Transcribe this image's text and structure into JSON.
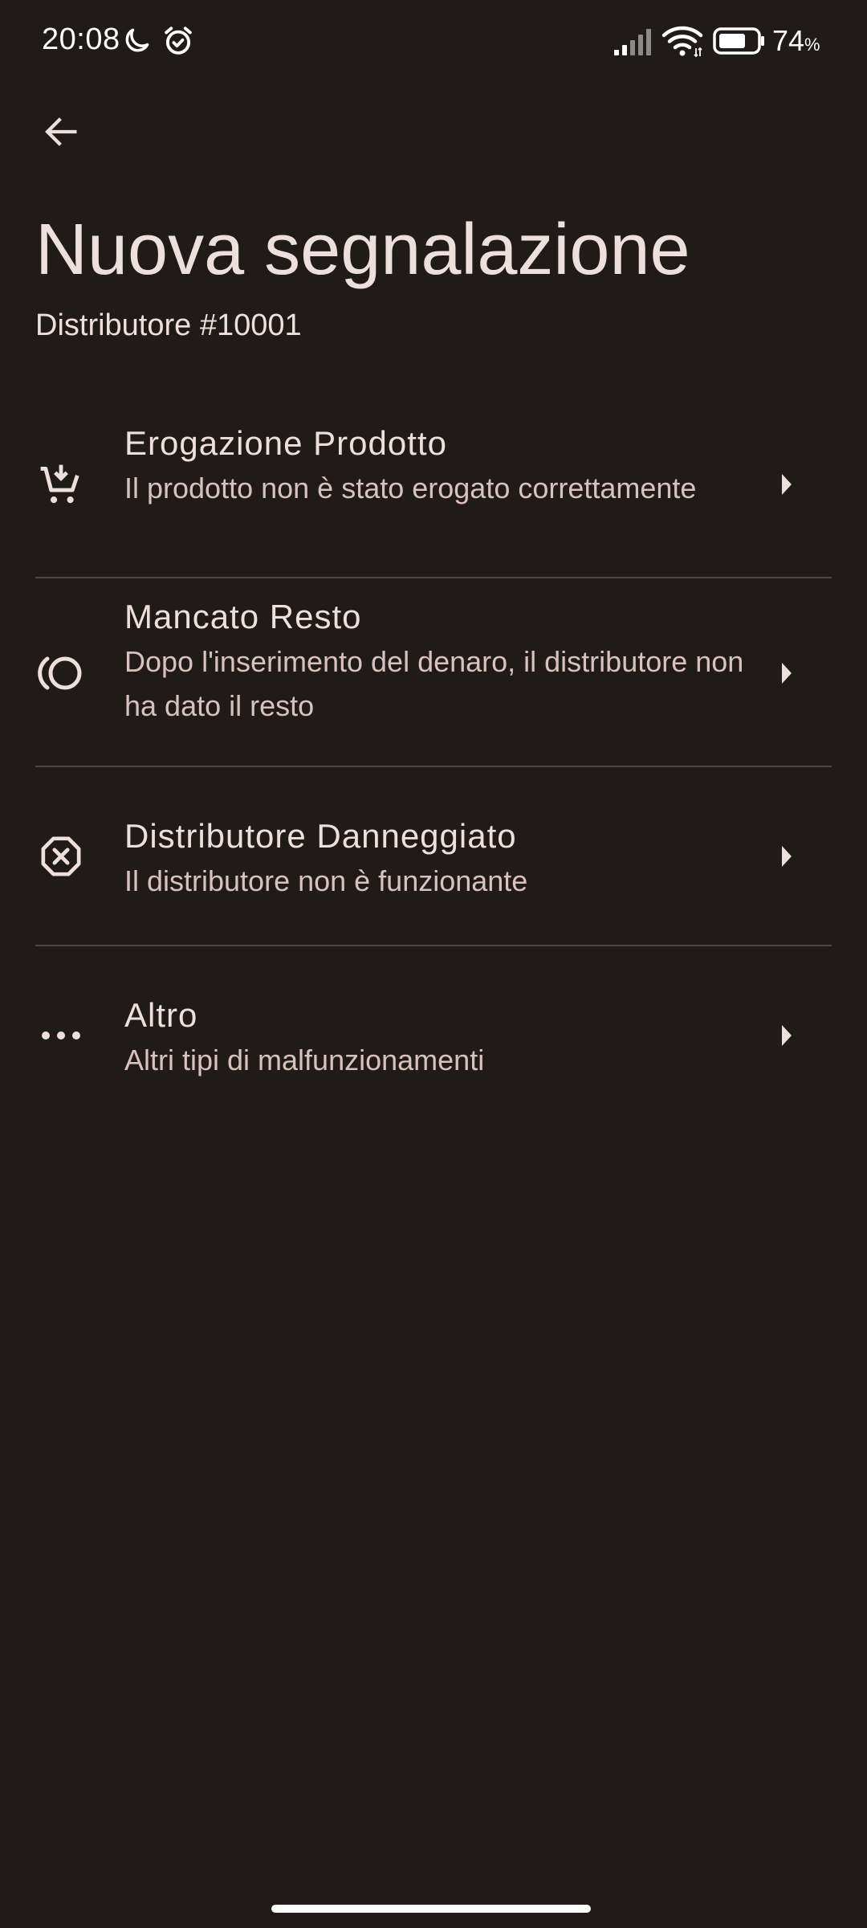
{
  "status_bar": {
    "time": "20:08",
    "battery_percent": "74",
    "battery_unit": "%",
    "icons": [
      "moon-icon",
      "alarm-icon",
      "signal-icon",
      "wifi-icon",
      "battery-icon"
    ]
  },
  "app_bar": {
    "back_icon": "arrow-back-icon",
    "title": "Nuova segnalazione",
    "subtitle": "Distributore #10001"
  },
  "issues": [
    {
      "icon": "cart-icon",
      "title": "Erogazione Prodotto",
      "description": "Il prodotto non è stato erogato correttamente"
    },
    {
      "icon": "coins-icon",
      "title": "Mancato Resto",
      "description": "Dopo l'inserimento del denaro, il distributore non ha dato il resto"
    },
    {
      "icon": "cancel-octagon-icon",
      "title": "Distributore Danneggiato",
      "description": "Il distributore non è funzionante"
    },
    {
      "icon": "more-horiz-icon",
      "title": "Altro",
      "description": "Altri tipi di malfunzionamenti"
    }
  ],
  "colors": {
    "background": "#201a19",
    "on_surface": "#ede0dc",
    "on_surface_variant": "#d8c2be",
    "divider": "#534341"
  }
}
